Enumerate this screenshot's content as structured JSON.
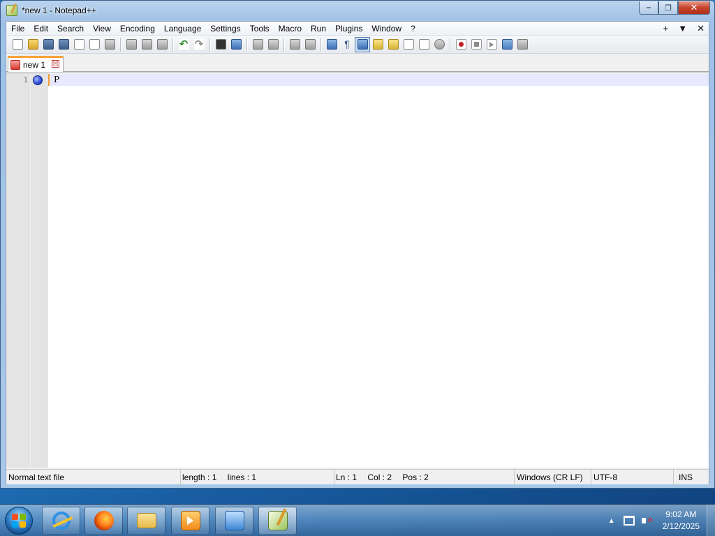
{
  "window": {
    "title": "*new 1 - Notepad++",
    "caption": {
      "minimize": "–",
      "maximize": "❐",
      "close": "✕"
    }
  },
  "menu": {
    "items": [
      "File",
      "Edit",
      "Search",
      "View",
      "Encoding",
      "Language",
      "Settings",
      "Tools",
      "Macro",
      "Run",
      "Plugins",
      "Window",
      "?"
    ],
    "right": {
      "plus": "+",
      "dropdown": "▼",
      "close": "✕"
    }
  },
  "toolbar": {
    "icons": [
      "new-icon",
      "open-icon",
      "save-icon",
      "save-all-icon",
      "close-icon",
      "close-all-icon",
      "print-icon",
      "cut-icon",
      "copy-icon",
      "paste-icon",
      "undo-icon",
      "redo-icon",
      "find-icon",
      "replace-icon",
      "zoom-in-icon",
      "zoom-out-icon",
      "sync-vertical-icon",
      "sync-horizontal-icon",
      "word-wrap-icon",
      "show-all-characters-icon",
      "indent-guide-icon",
      "user-defined-language-icon",
      "document-map-icon",
      "function-list-icon",
      "folder-as-workspace-icon",
      "monitoring-icon",
      "record-macro-icon",
      "stop-recording-icon",
      "playback-icon",
      "run-macro-multiple-icon",
      "save-macro-icon"
    ],
    "active": "indent-guide-icon"
  },
  "tabs": [
    {
      "label": "new 1",
      "modified": true,
      "close": "☒"
    }
  ],
  "editor": {
    "lines": [
      {
        "number": "1",
        "text": "P",
        "bookmarked": true
      }
    ]
  },
  "status": {
    "file_type": "Normal text file",
    "length": "length : 1",
    "lines": "lines : 1",
    "ln": "Ln : 1",
    "col": "Col : 2",
    "pos": "Pos : 2",
    "eol": "Windows (CR LF)",
    "encoding": "UTF-8",
    "mode": "INS"
  },
  "taskbar": {
    "apps": [
      "internet-explorer",
      "firefox",
      "windows-explorer",
      "windows-media-player",
      "network",
      "notepad-plus-plus"
    ],
    "active_app": "notepad-plus-plus",
    "tray_arrow": "▲",
    "clock": {
      "time": "9:02 AM",
      "date": "2/12/2025"
    }
  },
  "colors": {
    "tab_accent": "#f9a03a",
    "current_line": "#e8e8ff",
    "bookmark": "#2a4ad8"
  }
}
